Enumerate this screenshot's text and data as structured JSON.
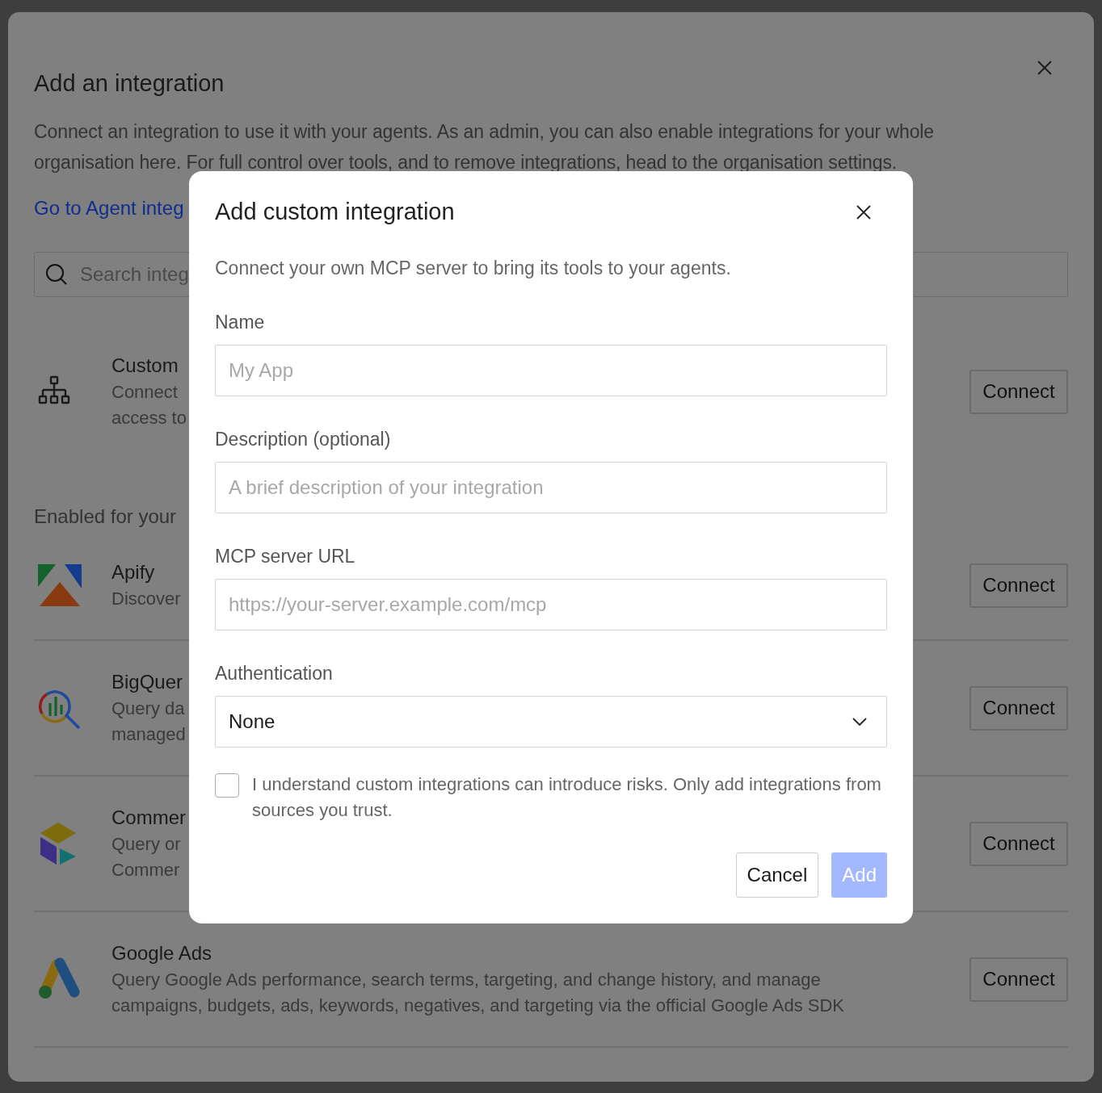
{
  "background_dialog": {
    "title": "Add an integration",
    "description": "Connect an integration to use it with your agents. As an admin, you can also enable integrations for your whole organisation here. For full control over tools, and to remove integrations, head to the organisation settings.",
    "link": "Go to Agent integ",
    "search": {
      "placeholder": "Search integ"
    },
    "custom_item": {
      "kind": "custom",
      "name": "Custom",
      "lines": [
        "Connect",
        "access to"
      ],
      "button": "Connect"
    },
    "section_heading": "Enabled for your",
    "integrations": [
      {
        "kind": "apify",
        "name": "Apify",
        "lines": [
          "Discover"
        ],
        "button": "Connect"
      },
      {
        "kind": "bigquery",
        "name": "BigQuer",
        "lines": [
          "Query da",
          "managed"
        ],
        "button": "Connect"
      },
      {
        "kind": "commerce",
        "name": "Commer",
        "lines": [
          "Query or",
          "Commer"
        ],
        "button": "Connect"
      },
      {
        "kind": "google-ads",
        "name": "Google Ads",
        "lines": [
          "Query Google Ads performance, search terms, targeting, and change history, and manage",
          "campaigns, budgets, ads, keywords, negatives, and targeting via the official Google Ads SDK"
        ],
        "button": "Connect"
      }
    ]
  },
  "dialog": {
    "title": "Add custom integration",
    "subtitle": "Connect your own MCP server to bring its tools to your agents.",
    "fields": [
      {
        "kind": "text",
        "label": "Name",
        "placeholder": "My App"
      },
      {
        "kind": "text",
        "label": "Description (optional)",
        "placeholder": "A brief description of your integration"
      },
      {
        "kind": "text",
        "label": "MCP server URL",
        "placeholder": "https://your-server.example.com/mcp"
      },
      {
        "kind": "select",
        "label": "Authentication",
        "value": "None"
      }
    ],
    "consent": {
      "checked": false,
      "text": "I understand custom integrations can introduce risks. Only add integrations from sources you trust."
    },
    "buttons": [
      {
        "kind": "secondary",
        "label": "Cancel",
        "disabled": false
      },
      {
        "kind": "primary",
        "label": "Add",
        "disabled": true
      }
    ]
  }
}
